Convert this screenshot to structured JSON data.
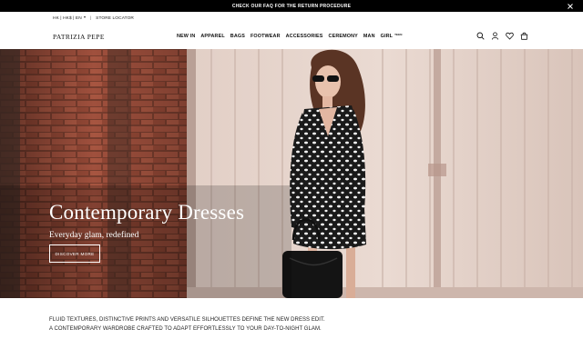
{
  "announcement": {
    "text": "CHECK OUR FAQ FOR THE RETURN PROCEDURE",
    "close_icon": "close-icon"
  },
  "utility": {
    "region": "HK | HK$ | EN",
    "store_locator": "STORE LOCATOR"
  },
  "header": {
    "logo": "PATRIZIA PEPE",
    "nav": [
      {
        "label": "NEW IN"
      },
      {
        "label": "APPAREL"
      },
      {
        "label": "BAGS"
      },
      {
        "label": "FOOTWEAR"
      },
      {
        "label": "ACCESSORIES"
      },
      {
        "label": "CEREMONY"
      },
      {
        "label": "MAN"
      },
      {
        "label": "GIRL",
        "badge": "TEEN"
      }
    ],
    "icons": [
      "search-icon",
      "account-icon",
      "wishlist-icon",
      "bag-icon"
    ]
  },
  "hero": {
    "title": "Contemporary Dresses",
    "subtitle": "Everyday glam, redefined",
    "cta": "DISCOVER MORE"
  },
  "copy": {
    "line1": "FLUID TEXTURES, DISTINCTIVE PRINTS AND VERSATILE SILHOUETTES DEFINE THE NEW DRESS EDIT.",
    "line2": "A CONTEMPORARY WARDROBE CRAFTED TO ADAPT EFFORTLESSLY TO YOUR DAY-TO-NIGHT GLAM."
  }
}
